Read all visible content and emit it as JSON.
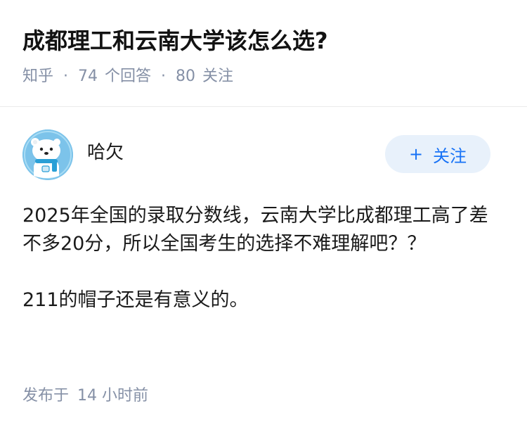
{
  "question": {
    "title": "成都理工和云南大学该怎么选?",
    "source": "知乎",
    "answers_count": "74",
    "answers_label": "个回答",
    "followers_count": "80",
    "followers_label": "关注"
  },
  "author": {
    "name": "哈欠",
    "avatar_icon": "polar-bear-avatar-icon",
    "follow_label": "关注"
  },
  "answer": {
    "paragraphs": [
      "2025年全国的录取分数线，云南大学比成都理工高了差不多20分，所以全国考生的选择不难理解吧？？",
      "211的帽子还是有意义的。"
    ],
    "published_prefix": "发布于",
    "published_time": "14 小时前"
  },
  "colors": {
    "accent": "#1772f6",
    "follow_bg": "#e8f1fb",
    "meta_gray": "#8590a6",
    "avatar_bg": "#7cc3ea"
  }
}
